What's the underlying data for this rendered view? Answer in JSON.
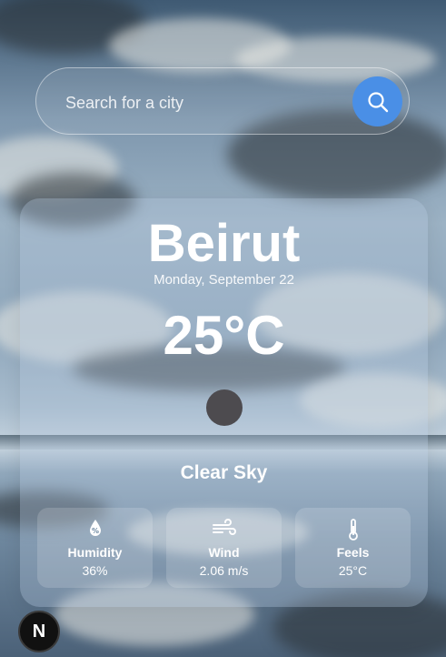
{
  "search": {
    "placeholder": "Search for a city",
    "button_icon": "search-icon",
    "accent": "#4a8fe6"
  },
  "weather": {
    "city": "Beirut",
    "date": "Monday, September 22",
    "temperature": "25°C",
    "condition": "Clear Sky",
    "icon": "weather-icon"
  },
  "stats": [
    {
      "icon": "humidity-icon",
      "label": "Humidity",
      "value": "36%"
    },
    {
      "icon": "wind-icon",
      "label": "Wind",
      "value": "2.06 m/s"
    },
    {
      "icon": "thermometer-icon",
      "label": "Feels",
      "value": "25°C"
    }
  ],
  "badge": {
    "label": "N",
    "icon": "nextjs-icon"
  }
}
